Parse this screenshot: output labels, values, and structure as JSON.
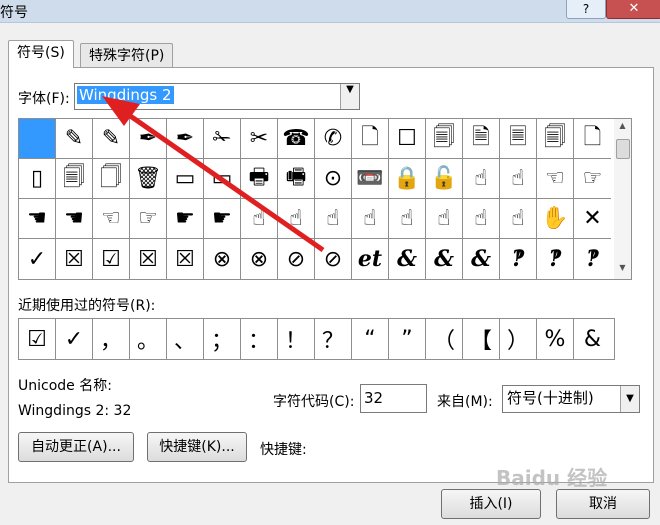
{
  "window": {
    "title": "符号",
    "help": "?",
    "close": "✕"
  },
  "tabs": [
    {
      "label": "符号(S)"
    },
    {
      "label": "特殊字符(P)"
    }
  ],
  "font": {
    "label": "字体(F):",
    "value": "Wingdings 2"
  },
  "grid": {
    "rows": [
      [
        "",
        "✎",
        "✎",
        "✒",
        "✒",
        "✁",
        "✂",
        "☎",
        "✆",
        "🗋",
        "☐",
        "🗐",
        "🗎",
        "🗏",
        "🗐",
        "🗋"
      ],
      [
        "▯",
        "🗐",
        "🗍",
        "🗑",
        "▭",
        "▭",
        "🖶",
        "🖷",
        "⊙",
        "📼",
        "🔒",
        "🔓",
        "☝",
        "☝",
        "☜",
        "☞"
      ],
      [
        "☚",
        "☚",
        "☜",
        "☞",
        "☛",
        "☛",
        "☝",
        "☝",
        "☝",
        "☝",
        "☝",
        "☝",
        "☝",
        "☝",
        "✋",
        "✕"
      ],
      [
        "✓",
        "☒",
        "☑",
        "☒",
        "☒",
        "⊗",
        "⊗",
        "⊘",
        "⊘",
        "et",
        "&",
        "&",
        "&",
        "‽",
        "‽",
        "‽"
      ]
    ],
    "selected": "0-0"
  },
  "recent": {
    "label": "近期使用过的符号(R):",
    "items": [
      "☑",
      "✓",
      "，",
      "。",
      "、",
      "；",
      "：",
      "！",
      "？",
      "“",
      "”",
      "（",
      "【",
      "）",
      "%",
      "&"
    ]
  },
  "unicode": {
    "label": "Unicode 名称:",
    "value": "Wingdings 2: 32"
  },
  "charcode": {
    "label": "字符代码(C):",
    "value": "32"
  },
  "from": {
    "label": "来自(M):",
    "value": "符号(十进制)"
  },
  "buttons": {
    "autocorrect": "自动更正(A)...",
    "shortcut_key": "快捷键(K)...",
    "shortcut_label": "快捷键:",
    "insert": "插入(I)",
    "cancel": "取消"
  },
  "watermark": "Baidu 经验",
  "colors": {
    "accent": "#3399ff",
    "arrow": "#e02020"
  }
}
